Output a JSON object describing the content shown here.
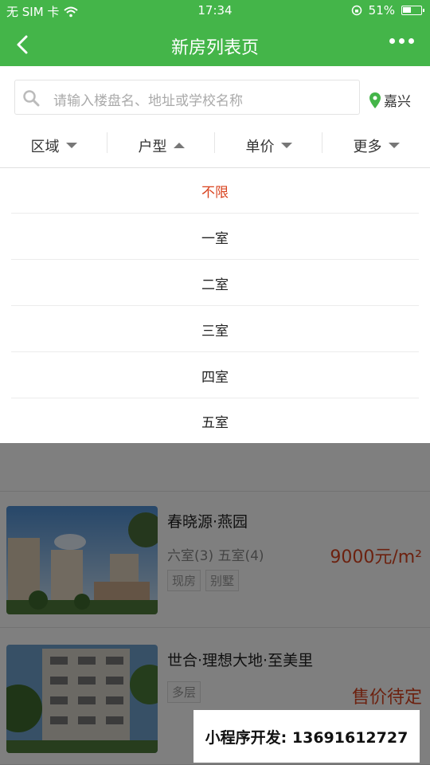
{
  "status": {
    "carrier": "无 SIM 卡",
    "time": "17:34",
    "battery": "51%",
    "battery_level": 0.51
  },
  "nav": {
    "title": "新房列表页"
  },
  "search": {
    "placeholder": "请输入楼盘名、地址或学校名称",
    "city": "嘉兴"
  },
  "filters": [
    {
      "label": "区域",
      "state": "collapsed"
    },
    {
      "label": "户型",
      "state": "expanded"
    },
    {
      "label": "单价",
      "state": "collapsed"
    },
    {
      "label": "更多",
      "state": "collapsed"
    }
  ],
  "dropdown": {
    "options": [
      "不限",
      "一室",
      "二室",
      "三室",
      "四室",
      "五室"
    ],
    "selected": "不限"
  },
  "listings": [
    {
      "name": "春晓源·燕园",
      "types": "六室(3) 五室(4)",
      "tags": [
        "现房",
        "别墅"
      ],
      "price": "9000元/m²"
    },
    {
      "name": "世合·理想大地·至美里",
      "types": "",
      "tags": [
        "多层"
      ],
      "price": "售价待定"
    }
  ],
  "promo": {
    "text": "小程序开发: 13691612727"
  },
  "colors": {
    "brand": "#44b549",
    "price": "#d9431f",
    "selected": "#d9431f"
  }
}
